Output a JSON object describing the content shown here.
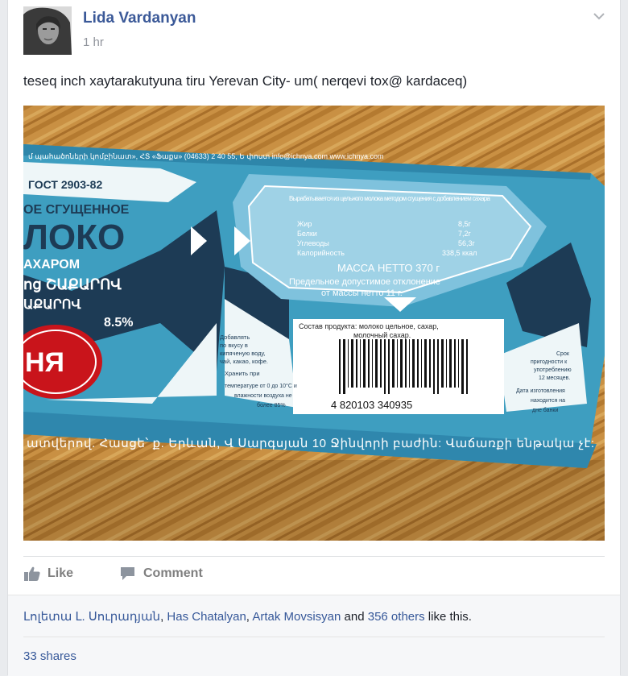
{
  "post": {
    "author": "Lida Vardanyan",
    "time": "1 hr",
    "message": "teseq inch xaytarakutyuna tiru Yerevan City- um( nerqevi tox@ kardaceq)"
  },
  "photo": {
    "gost": "ГОСТ 2903-82",
    "brand_line1": "ОЕ СГУЩЕННОЕ",
    "brand_line2": "ЛОКО",
    "brand_line3": "АХАРОМ",
    "arm_line1": "ոց ՇԱՔԱՐՈՎ",
    "arm_line2": "ԱՔԱՐՈՎ",
    "fat": "8.5%",
    "logo_text": "НЯ",
    "top_strip": "մ պահածոների կոմբինատ», ՀՏ «Ֆաքս»  (04633) 2 40 55, Ե փոստ info@ichnya.com  www.ichnya.com",
    "mass": "МАССА НЕТТО 370 г",
    "deviation_line1": "Предельное допустимое отклонение",
    "deviation_line2": "от массы нетто 11 г.",
    "composition_line1": "Состав продукта: молоко цельное, сахар,",
    "composition_line2": "молочный сахар.",
    "barcode": "4 820103 340935",
    "usage_lines": [
      "Добавлять",
      "по вкусу в",
      "кипяченую воду,",
      "чай, какао, кофе.",
      "Хранить при",
      "температуре от 0 до 10°С и",
      "влажности воздуха не",
      "более 85%"
    ],
    "shelf_lines": [
      "Срок",
      "пригодности к",
      "употреблению",
      "12 месяцев.",
      "Дата изготовления",
      "находится на",
      "дне банки"
    ],
    "bottom_strip": "ատվերով. Հասցե՝ ք. Երևան, Վ Սարգսյան 10 Ջինվորի բաժին: Վաճառքի ենթակա չէ:",
    "nutrition_title": "Вырабатывается из цельного молока методом сгущения с добавлением сахара",
    "nutrition_rows": [
      {
        "label": "Жир",
        "value": "8,5г"
      },
      {
        "label": "Белки",
        "value": "7,2г"
      },
      {
        "label": "Углеводы",
        "value": "56,3г"
      },
      {
        "label": "Калорийность",
        "value": "338,5 ккал"
      }
    ]
  },
  "actions": {
    "like_label": "Like",
    "comment_label": "Comment"
  },
  "likes": {
    "name1": "Լոլետա Լ. Սուրադյան",
    "sep1": ", ",
    "name2": "Has Chatalyan",
    "sep2": ", ",
    "name3": "Artak Movsisyan",
    "and_text": " and ",
    "others": "356 others",
    "tail": " like this."
  },
  "shares": {
    "label": "33 shares"
  },
  "colors": {
    "link": "#3b5998",
    "label_teal": "#3e9ec0",
    "label_navy": "#1d3b55",
    "wood": "#c48a3c"
  },
  "icons": {
    "chevron": "chevron-down-icon",
    "like": "thumbs-up-icon",
    "comment": "speech-bubble-icon"
  }
}
